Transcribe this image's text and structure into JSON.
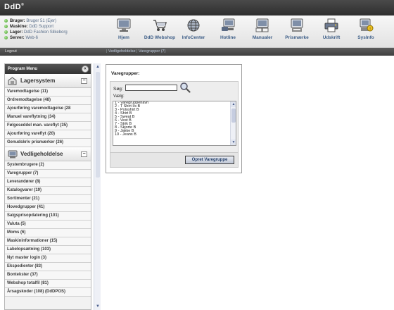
{
  "app": {
    "logo": "DdD",
    "logo_mark": "®"
  },
  "header": {
    "info": [
      {
        "label": "Bruger:",
        "value": "Bruger 51 (Ejer)"
      },
      {
        "label": "Maskine:",
        "value": "DdD Support"
      },
      {
        "label": "Lager:",
        "value": "DdD Fashion Silkeborg"
      },
      {
        "label": "Server:",
        "value": "Web-6"
      }
    ],
    "toolbar": [
      {
        "label": "Hjem",
        "icon": "monitor-icon"
      },
      {
        "label": "DdD Webshop",
        "icon": "cart-icon"
      },
      {
        "label": "InfoCenter",
        "icon": "globe-icon"
      },
      {
        "label": "Hotline",
        "icon": "phone-monitor-icon"
      },
      {
        "label": "Manualer",
        "icon": "manual-monitor-icon"
      },
      {
        "label": "Prismærke",
        "icon": "label-monitor-icon"
      },
      {
        "label": "Udskrift",
        "icon": "printer-icon"
      },
      {
        "label": "SysInfo",
        "icon": "sysinfo-icon"
      }
    ]
  },
  "nav": {
    "logout": "Logout",
    "breadcrumb": [
      "Vedligeholdelse",
      "Varegrupper (7)"
    ],
    "separator": "|"
  },
  "sidebar": {
    "title": "Program Menu",
    "collapse_glyph": "«",
    "sections": [
      {
        "title": "Lagersystem",
        "items": [
          "Varemodtagelse (11)",
          "Ordremodtagelse (48)",
          "Ajourføring varemodtagelse (28",
          "Manuel vareflytning (34)",
          "Følgeseddel man. vareflyt (35)",
          "Ajourføring vareflyt (20)",
          "Genudskriv prismærker (26)"
        ]
      },
      {
        "title": "Vedligeholdelse",
        "items": [
          "Systembrugere (2)",
          "Varegrupper (7)",
          "Leverandører (8)",
          "Katalogvarer (19)",
          "Sortimenter (21)",
          "Hovedgrupper (41)",
          "Salgsprisopdatering (101)",
          "Valuta (5)",
          "Moms (6)",
          "Maskininformationer (15)",
          "Labelopsætning (103)",
          "Nyt master login (3)",
          "Ekspedienter (83)",
          "Bontekster (37)",
          "Webshop totalfil (81)",
          "Årsagskoder (108) (DdDPOS)"
        ]
      }
    ]
  },
  "panel": {
    "title": "Varegrupper:",
    "search_label": "Søg:",
    "search_value": "",
    "choose_label": "Vælg:",
    "options": [
      "1 - Varegruppenavn",
      "2 - T Shirt l/s B",
      "3 - Poloshirt B",
      "4 - Shirt B",
      "5 - Sweat B",
      "6 - Vest B",
      "7 - Strik B",
      "8 - Skjorte B",
      "9 - Jakke B",
      "10 - Jeans B"
    ],
    "create_button": "Opret Varegruppe"
  },
  "colors": {
    "accent": "#3c5d87",
    "status_ok": "#3c9a1e",
    "topbar": "#3a3a3a"
  }
}
